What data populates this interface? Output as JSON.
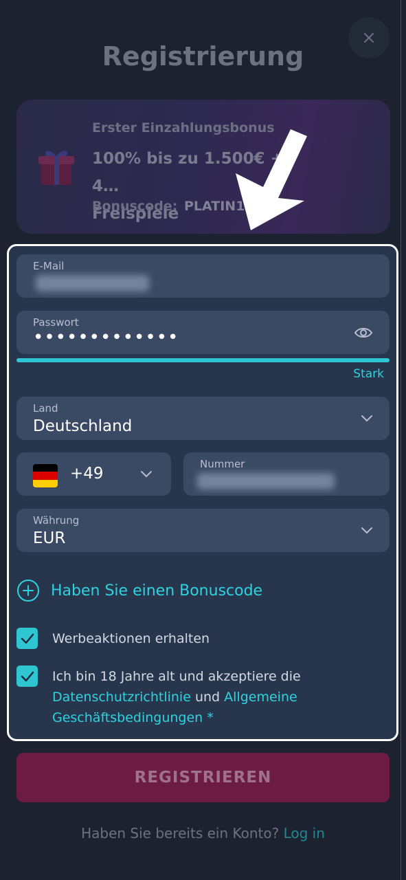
{
  "header": {
    "title": "Registrierung",
    "close_icon": "close-icon"
  },
  "bonus": {
    "kicker": "Erster Einzahlungsbonus",
    "headline": "100% bis zu 1.500€ + 4…",
    "headline_line2": "Freispiele",
    "code_label": "Bonuscode:",
    "code_value": "PLATIN1…",
    "icon": "gift-icon"
  },
  "form": {
    "email": {
      "label": "E-Mail",
      "value": ""
    },
    "password": {
      "label": "Passwort",
      "value": "•••••••••••••",
      "icon": "eye-icon"
    },
    "strength": {
      "label": "Stark",
      "level": 1.0
    },
    "country": {
      "label": "Land",
      "value": "Deutschland"
    },
    "phone": {
      "prefix": "+49",
      "number_label": "Nummer",
      "number_value": ""
    },
    "currency": {
      "label": "Währung",
      "value": "EUR"
    },
    "promo": {
      "label": "Haben Sie einen Bonuscode"
    },
    "checks": {
      "promotions": {
        "label": "Werbeaktionen erhalten",
        "checked": true
      },
      "terms": {
        "prefix": "Ich bin 18 Jahre alt und akzeptiere die",
        "privacy_link": "Datenschutzrichtlinie",
        "and": "und",
        "terms_link": "Allgemeine Geschäftsbedingungen",
        "required": "*",
        "checked": true
      }
    }
  },
  "actions": {
    "register": "REGISTRIEREN",
    "login_prompt": "Haben Sie bereits ein Konto?",
    "login_link": "Log in"
  },
  "colors": {
    "background": "#1c2230",
    "accent": "#2fd3df",
    "panel": "#27354d",
    "field": "#3a4964",
    "register_button": "#6b1c40"
  }
}
